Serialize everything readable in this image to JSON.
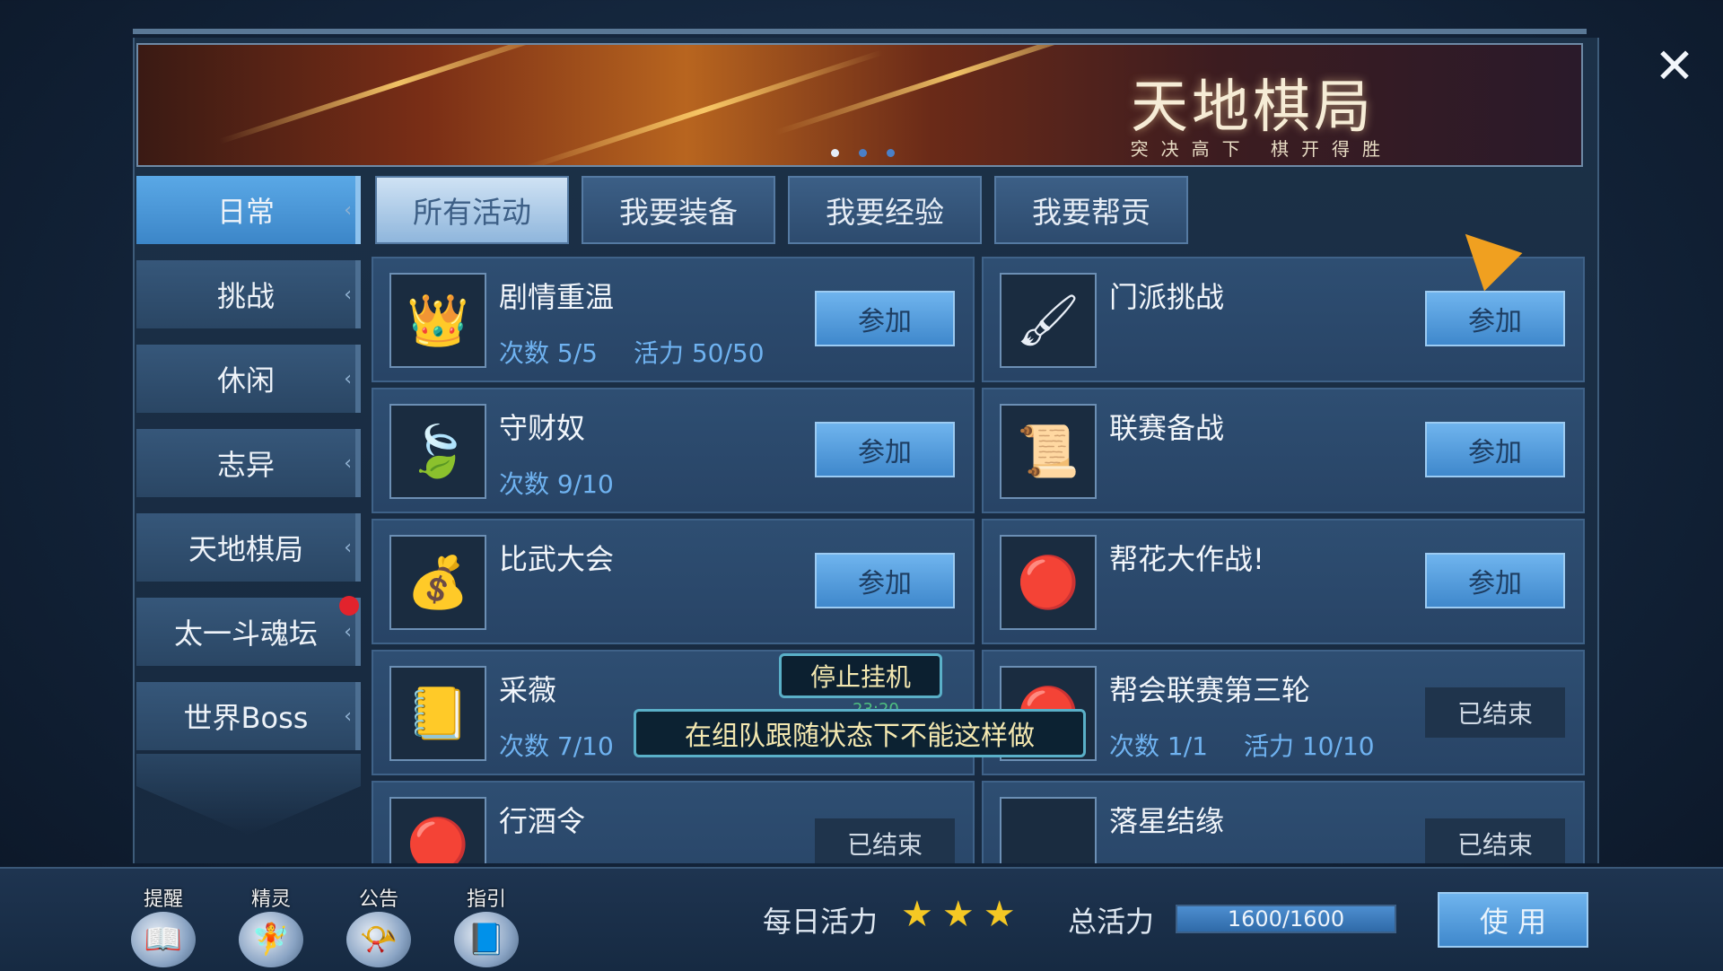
{
  "banner": {
    "title": "天地棋局",
    "subtitle": "突决高下  棋开得胜",
    "dots": [
      true,
      false,
      false
    ]
  },
  "close_label": "✕",
  "sidebar": {
    "items": [
      {
        "label": "日常",
        "active": true,
        "badge": false
      },
      {
        "label": "挑战",
        "active": false,
        "badge": false
      },
      {
        "label": "休闲",
        "active": false,
        "badge": false
      },
      {
        "label": "志异",
        "active": false,
        "badge": false
      },
      {
        "label": "天地棋局",
        "active": false,
        "badge": false
      },
      {
        "label": "太一斗魂坛",
        "active": false,
        "badge": true
      },
      {
        "label": "世界Boss",
        "active": false,
        "badge": false
      }
    ]
  },
  "tabs": [
    {
      "label": "所有活动",
      "active": true
    },
    {
      "label": "我要装备",
      "active": false
    },
    {
      "label": "我要经验",
      "active": false
    },
    {
      "label": "我要帮贡",
      "active": false
    }
  ],
  "activities": [
    {
      "name": "剧情重温",
      "icon": "helmet-icon",
      "glyph": "👑",
      "count": "次数 5/5",
      "vigor": "活力 50/50",
      "action": "参加",
      "ended": false
    },
    {
      "name": "门派挑战",
      "icon": "brush-icon",
      "glyph": "🖌",
      "count": "",
      "vigor": "",
      "action": "参加",
      "ended": false
    },
    {
      "name": "守财奴",
      "icon": "leaf-icon",
      "glyph": "🍃",
      "count": "次数 9/10",
      "vigor": "",
      "action": "参加",
      "ended": false
    },
    {
      "name": "联赛备战",
      "icon": "letter-icon",
      "glyph": "📜",
      "count": "",
      "vigor": "",
      "action": "参加",
      "ended": false
    },
    {
      "name": "比武大会",
      "icon": "money-bag-icon",
      "glyph": "💰",
      "count": "",
      "vigor": "",
      "action": "参加",
      "ended": false
    },
    {
      "name": "帮花大作战!",
      "icon": "guild-token-icon",
      "glyph": "🔴",
      "count": "",
      "vigor": "",
      "action": "参加",
      "ended": false
    },
    {
      "name": "采薇",
      "icon": "book-icon",
      "glyph": "📒",
      "count": "次数 7/10",
      "vigor": "",
      "action": "",
      "ended": false
    },
    {
      "name": "帮会联赛第三轮",
      "icon": "guild-token-icon",
      "glyph": "🔴",
      "count": "次数 1/1",
      "vigor": "活力 10/10",
      "action": "已结束",
      "ended": true
    },
    {
      "name": "行酒令",
      "icon": "guild-token-icon",
      "glyph": "🔴",
      "count": "",
      "vigor": "",
      "action": "已结束",
      "ended": true
    },
    {
      "name": "落星结缘",
      "icon": "empty-icon",
      "glyph": "",
      "count": "",
      "vigor": "",
      "action": "已结束",
      "ended": true
    }
  ],
  "overlay": {
    "stop_label": "停止挂机",
    "timer": "23:20",
    "toast": "在组队跟随状态下不能这样做"
  },
  "quickbar": [
    {
      "label": "提醒",
      "icon": "reminder-book-icon",
      "glyph": "📖"
    },
    {
      "label": "精灵",
      "icon": "sprite-icon",
      "glyph": "🧚"
    },
    {
      "label": "公告",
      "icon": "horn-icon",
      "glyph": "📯"
    },
    {
      "label": "指引",
      "icon": "guide-book-icon",
      "glyph": "📘"
    }
  ],
  "footer": {
    "daily_label": "每日活力",
    "stars": 3,
    "total_label": "总活力",
    "vigor_text": "1600/1600",
    "vigor_fraction": 1.0,
    "use_label": "使 用"
  }
}
